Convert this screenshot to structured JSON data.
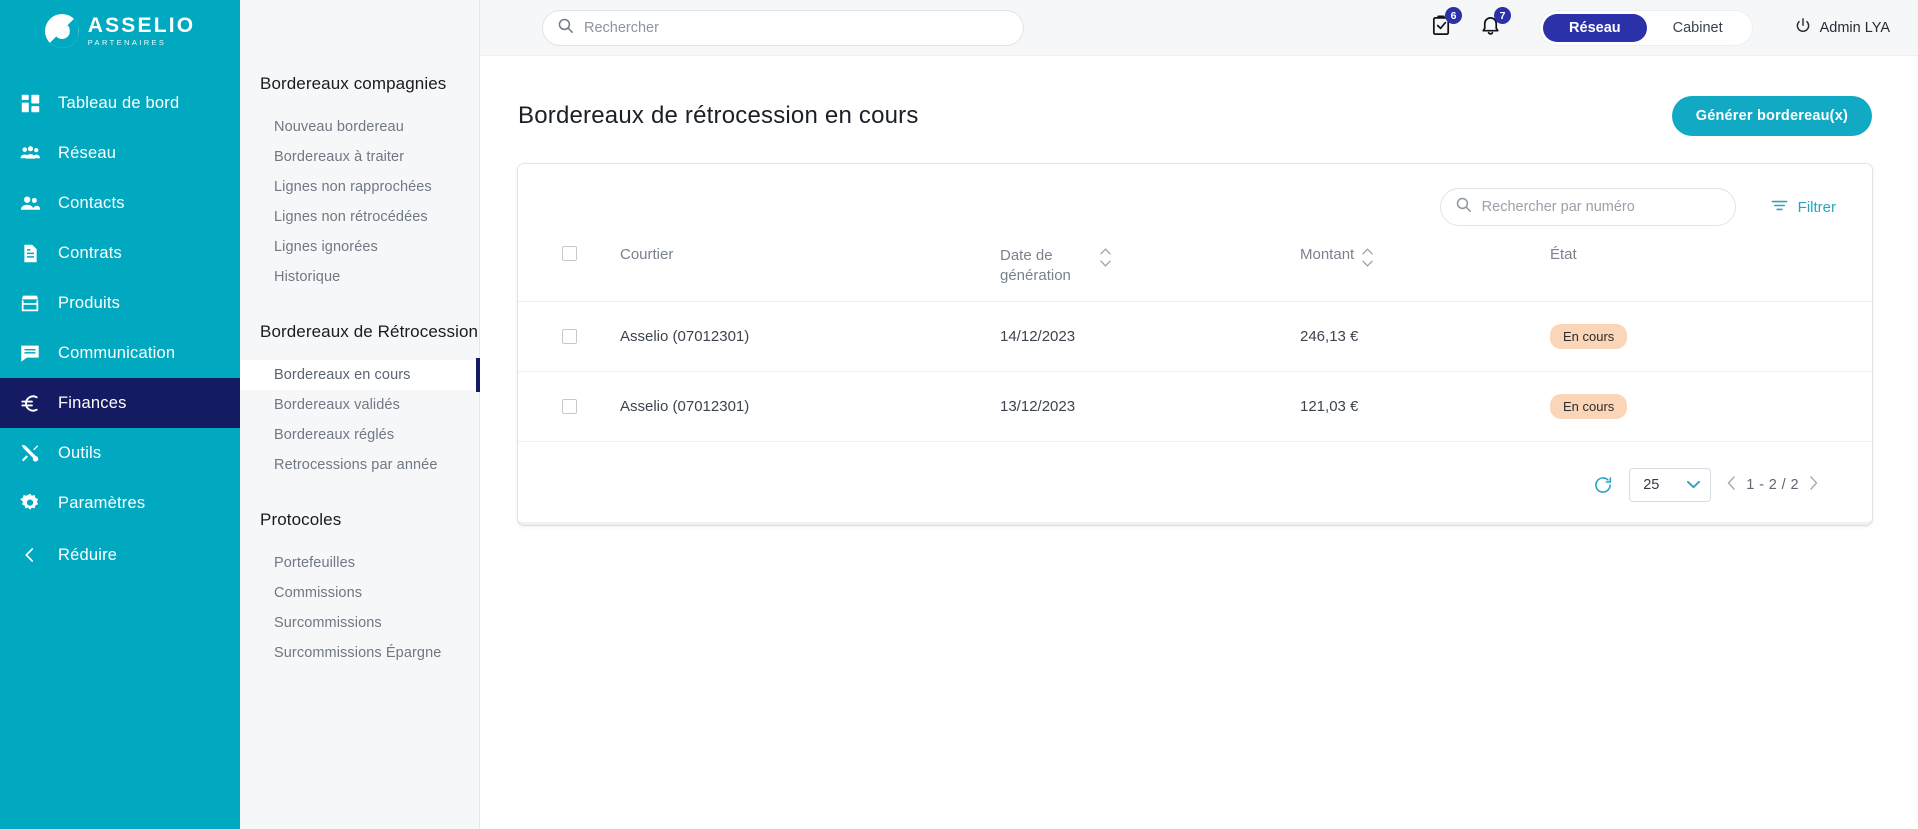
{
  "brand": {
    "title": "ASSELIO",
    "subtitle": "PARTENAIRES"
  },
  "sidebar": {
    "items": [
      {
        "label": "Tableau de bord",
        "icon": "dashboard-icon",
        "active": false
      },
      {
        "label": "Réseau",
        "icon": "network-icon",
        "active": false
      },
      {
        "label": "Contacts",
        "icon": "contacts-icon",
        "active": false
      },
      {
        "label": "Contrats",
        "icon": "document-icon",
        "active": false
      },
      {
        "label": "Produits",
        "icon": "store-icon",
        "active": false
      },
      {
        "label": "Communication",
        "icon": "message-icon",
        "active": false
      },
      {
        "label": "Finances",
        "icon": "euro-icon",
        "active": true
      },
      {
        "label": "Outils",
        "icon": "tools-icon",
        "active": false
      },
      {
        "label": "Paramètres",
        "icon": "gear-icon",
        "active": false
      },
      {
        "label": "Réduire",
        "icon": "chevron-left-icon",
        "active": false
      }
    ]
  },
  "subnav": {
    "groups": [
      {
        "title": "Bordereaux compagnies",
        "items": [
          {
            "label": "Nouveau bordereau",
            "active": false
          },
          {
            "label": "Bordereaux à traiter",
            "active": false
          },
          {
            "label": "Lignes non rapprochées",
            "active": false
          },
          {
            "label": "Lignes non rétrocédées",
            "active": false
          },
          {
            "label": "Lignes ignorées",
            "active": false
          },
          {
            "label": "Historique",
            "active": false
          }
        ]
      },
      {
        "title": "Bordereaux de Rétrocession",
        "items": [
          {
            "label": "Bordereaux en cours",
            "active": true
          },
          {
            "label": "Bordereaux validés",
            "active": false
          },
          {
            "label": "Bordereaux réglés",
            "active": false
          },
          {
            "label": "Retrocessions par année",
            "active": false
          }
        ]
      },
      {
        "title": "Protocoles",
        "items": [
          {
            "label": "Portefeuilles",
            "active": false
          },
          {
            "label": "Commissions",
            "active": false
          },
          {
            "label": "Surcommissions",
            "active": false
          },
          {
            "label": "Surcommissions Épargne",
            "active": false
          }
        ]
      }
    ]
  },
  "topbar": {
    "search_placeholder": "Rechercher",
    "tasks_badge": "6",
    "notifications_badge": "7",
    "segment": {
      "left": "Réseau",
      "right": "Cabinet",
      "selected": "Réseau"
    },
    "user": "Admin LYA"
  },
  "page": {
    "title": "Bordereaux de rétrocession en cours",
    "generate_button": "Générer bordereau(x)"
  },
  "table_toolbar": {
    "search_placeholder": "Rechercher par numéro",
    "filter_label": "Filtrer"
  },
  "table": {
    "columns": [
      {
        "label": "",
        "key": "check"
      },
      {
        "label": "Courtier",
        "key": "courtier"
      },
      {
        "label": "Date de génération",
        "key": "date"
      },
      {
        "label": "Montant",
        "key": "montant"
      },
      {
        "label": "État",
        "key": "etat"
      }
    ],
    "rows": [
      {
        "courtier": "Asselio (07012301)",
        "date": "14/12/2023",
        "montant": "246,13 €",
        "etat": "En cours"
      },
      {
        "courtier": "Asselio (07012301)",
        "date": "13/12/2023",
        "montant": "121,03 €",
        "etat": "En cours"
      }
    ]
  },
  "pagination": {
    "page_size": "25",
    "range": "1 - 2 / 2"
  },
  "colors": {
    "sidebar": "#00A9C0",
    "sidebar_active": "#151B63",
    "accent": "#12A9C4",
    "segment_active": "#2B31A8",
    "status_bg": "#FAD5B8"
  }
}
